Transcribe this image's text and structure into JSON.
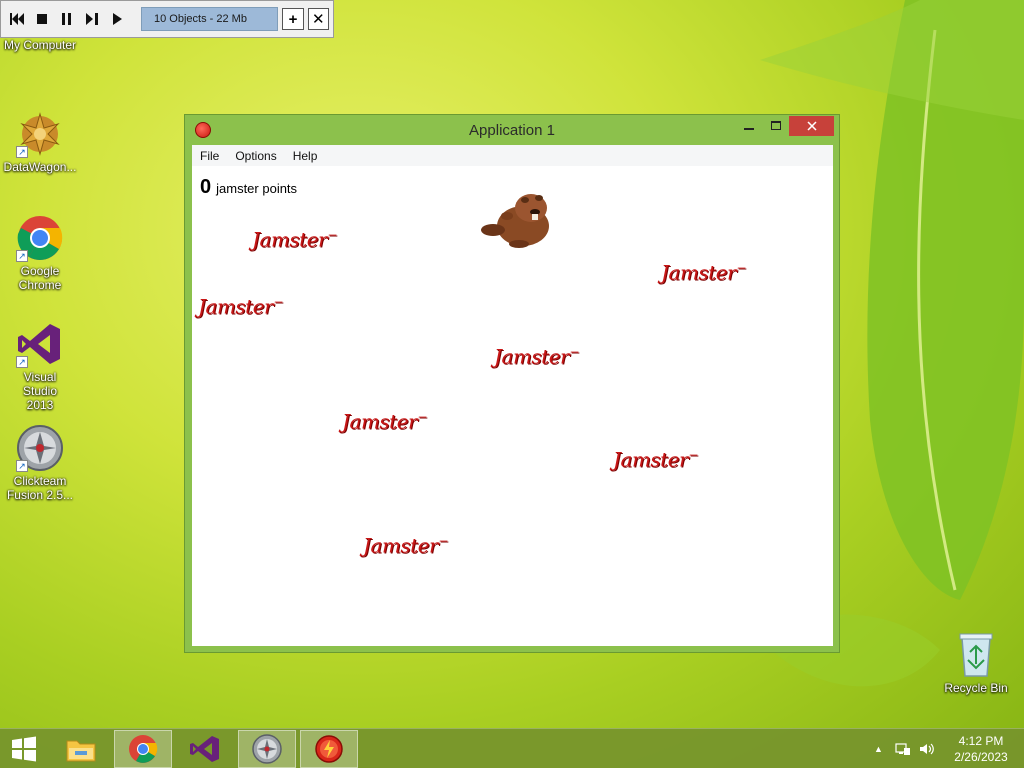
{
  "toolbar": {
    "status": "10 Objects - 22 Mb",
    "buttons": [
      "first-frame",
      "stop",
      "pause",
      "next-frame",
      "play"
    ]
  },
  "desktop": {
    "icons": [
      {
        "label": "My Computer"
      },
      {
        "label": "DataWagon..."
      },
      {
        "label": "Google Chrome"
      },
      {
        "label": "Visual Studio 2013"
      },
      {
        "label": "Clickteam Fusion 2.5..."
      }
    ],
    "recycle_bin": "Recycle Bin"
  },
  "window": {
    "title": "Application 1",
    "menu": [
      "File",
      "Options",
      "Help"
    ],
    "score_value": "0",
    "score_label": "jamster points",
    "jamster_label": "Jamster"
  },
  "taskbar": {
    "time": "4:12 PM",
    "date": "2/26/2023"
  },
  "colors": {
    "window_frame": "#8cc14c",
    "close_button": "#c7413a",
    "jamster_red": "#c81818",
    "taskbar": "#76942c"
  }
}
